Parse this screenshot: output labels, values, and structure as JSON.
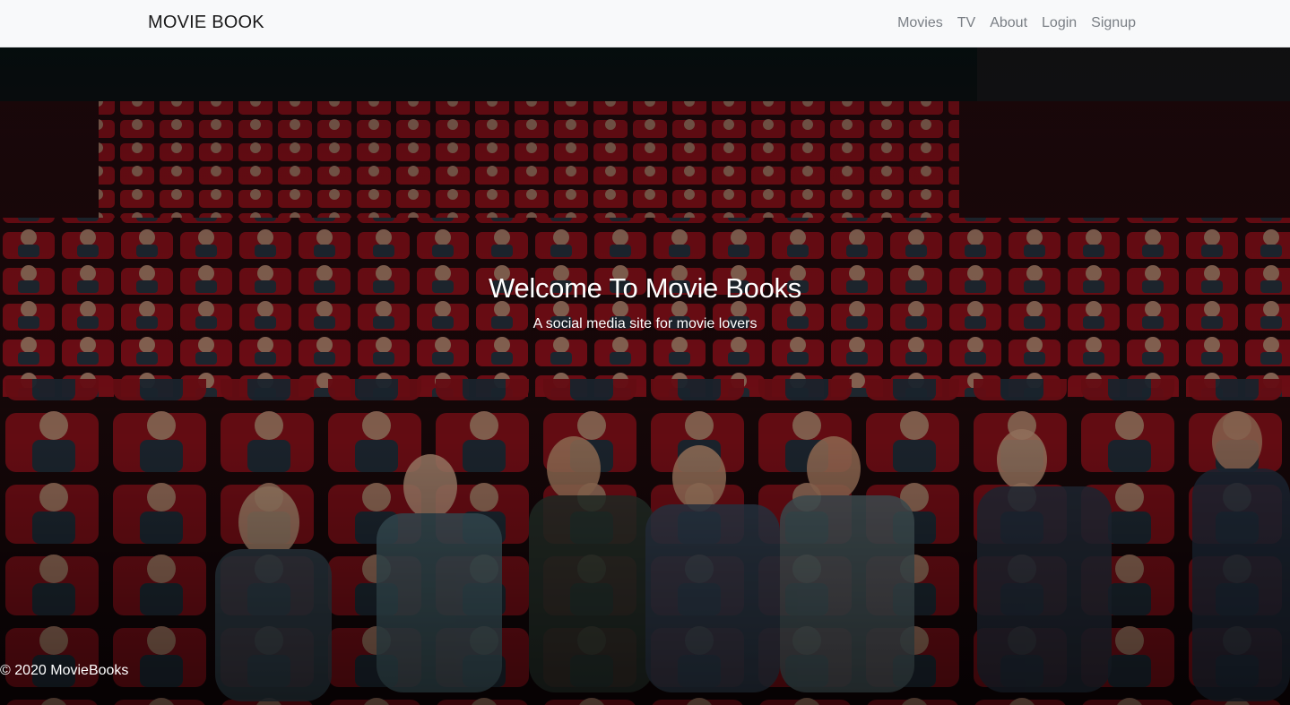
{
  "navbar": {
    "brand": "MOVIE BOOK",
    "links": [
      "Movies",
      "TV",
      "About",
      "Login",
      "Signup"
    ]
  },
  "hero": {
    "title": "Welcome To Movie Books",
    "subtitle": "A social media site for movie lovers",
    "background_image": "cinema-audience-photo",
    "accent_color": "#b3121d"
  },
  "footer": {
    "copyright": "© 2020 MovieBooks"
  }
}
